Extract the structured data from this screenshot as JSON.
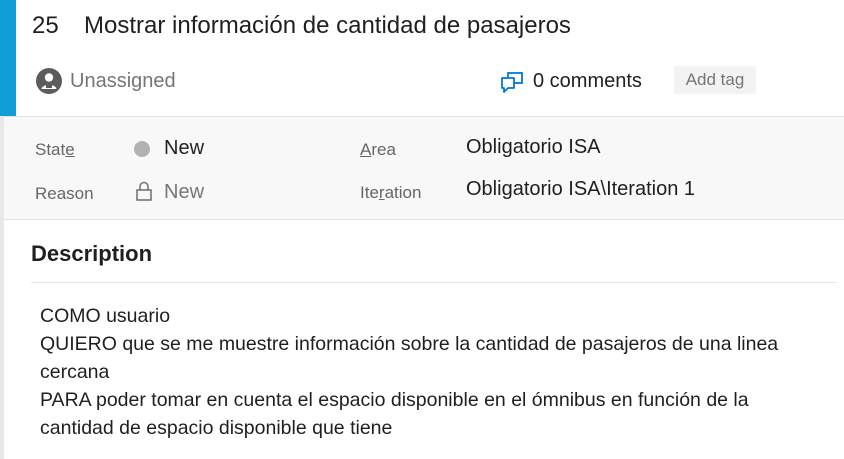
{
  "work_item": {
    "id": "25",
    "title": "Mostrar información de cantidad de pasajeros"
  },
  "header": {
    "assignee": "Unassigned",
    "assignee_icon": "user-avatar-icon",
    "comments": "0 comments",
    "comments_icon": "comments-icon",
    "add_tag": "Add tag"
  },
  "fields": {
    "state": {
      "label_pre": "Stat",
      "label_ul": "e",
      "value": "New"
    },
    "reason": {
      "label": "Reason",
      "value": "New",
      "icon": "lock-icon"
    },
    "area": {
      "label_ul": "A",
      "label_post": "rea",
      "value": "Obligatorio ISA"
    },
    "iteration": {
      "label_pre": "Ite",
      "label_ul": "r",
      "label_post": "ation",
      "value": "Obligatorio ISA\\Iteration 1"
    }
  },
  "description": {
    "heading": "Description",
    "lines": [
      "COMO usuario",
      "QUIERO que se me muestre información sobre la cantidad de pasajeros de una linea",
      "cercana",
      "PARA poder tomar en cuenta el espacio disponible en el ómnibus en función de la",
      "cantidad de espacio disponible que tiene"
    ]
  },
  "colors": {
    "accent": "#0f9fd6",
    "comments_icon": "#0078d4",
    "state_dot": "#b2b2b2"
  }
}
